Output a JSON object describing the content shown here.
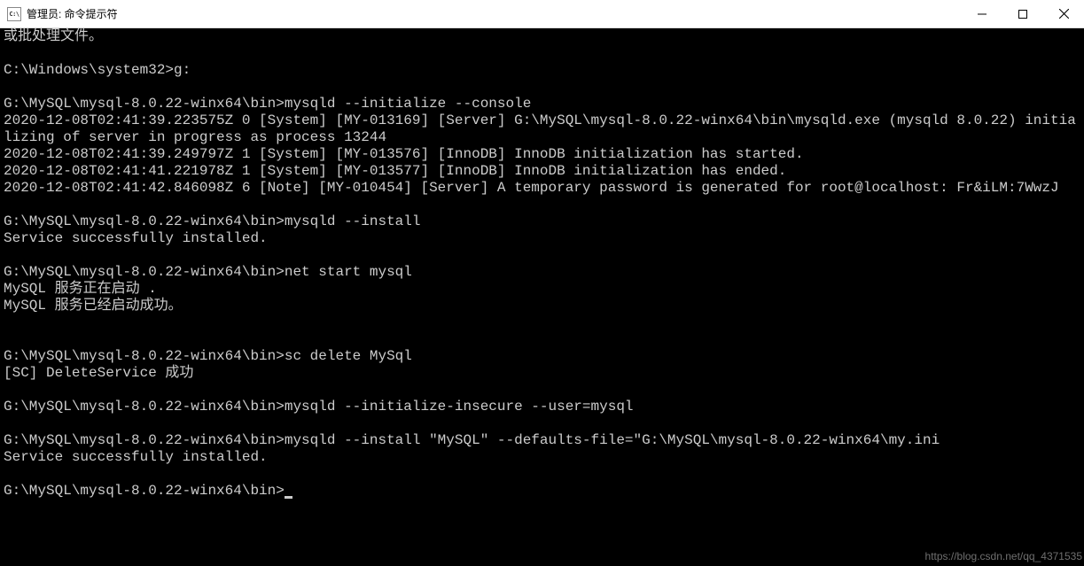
{
  "titlebar": {
    "icon_text": "C:\\",
    "title": "管理员: 命令提示符"
  },
  "terminal": {
    "lines": [
      "或批处理文件。",
      "",
      "C:\\Windows\\system32>g:",
      "",
      "G:\\MySQL\\mysql-8.0.22-winx64\\bin>mysqld --initialize --console",
      "2020-12-08T02:41:39.223575Z 0 [System] [MY-013169] [Server] G:\\MySQL\\mysql-8.0.22-winx64\\bin\\mysqld.exe (mysqld 8.0.22) initializing of server in progress as process 13244",
      "2020-12-08T02:41:39.249797Z 1 [System] [MY-013576] [InnoDB] InnoDB initialization has started.",
      "2020-12-08T02:41:41.221978Z 1 [System] [MY-013577] [InnoDB] InnoDB initialization has ended.",
      "2020-12-08T02:41:42.846098Z 6 [Note] [MY-010454] [Server] A temporary password is generated for root@localhost: Fr&iLM:7WwzJ",
      "",
      "G:\\MySQL\\mysql-8.0.22-winx64\\bin>mysqld --install",
      "Service successfully installed.",
      "",
      "G:\\MySQL\\mysql-8.0.22-winx64\\bin>net start mysql",
      "MySQL 服务正在启动 .",
      "MySQL 服务已经启动成功。",
      "",
      "",
      "G:\\MySQL\\mysql-8.0.22-winx64\\bin>sc delete MySql",
      "[SC] DeleteService 成功",
      "",
      "G:\\MySQL\\mysql-8.0.22-winx64\\bin>mysqld --initialize-insecure --user=mysql",
      "",
      "G:\\MySQL\\mysql-8.0.22-winx64\\bin>mysqld --install \"MySQL\" --defaults-file=\"G:\\MySQL\\mysql-8.0.22-winx64\\my.ini",
      "Service successfully installed.",
      ""
    ],
    "current_prompt": "G:\\MySQL\\mysql-8.0.22-winx64\\bin>"
  },
  "watermark": "https://blog.csdn.net/qq_4371535"
}
